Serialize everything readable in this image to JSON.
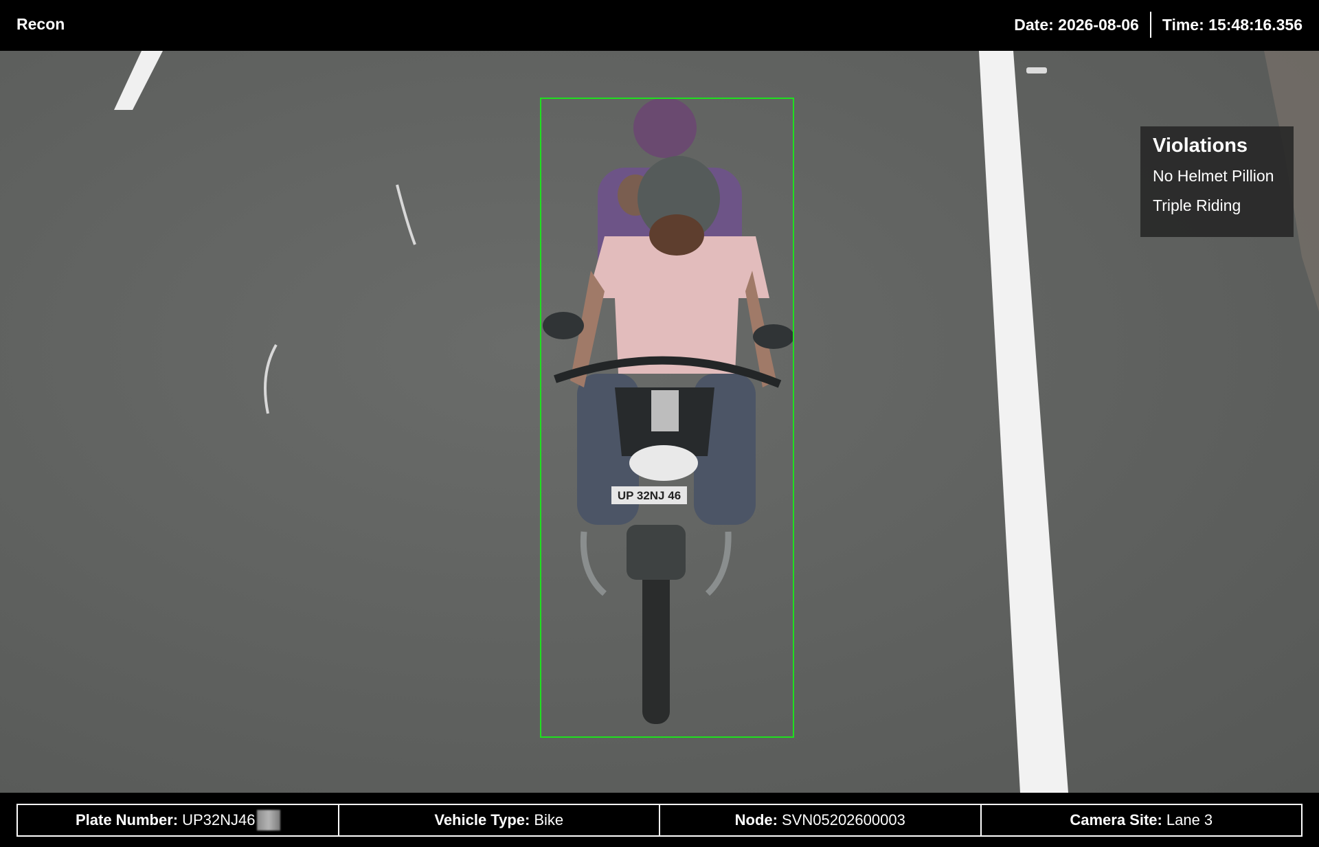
{
  "header": {
    "app_title": "Recon",
    "date_label": "Date:",
    "date_value": "2026-08-06",
    "time_label": "Time:",
    "time_value": "15:48:16.356"
  },
  "violations": {
    "title": "Violations",
    "items": [
      "No Helmet Pillion",
      "Triple Riding"
    ]
  },
  "camera": {
    "plate_on_vehicle": "UP 32NJ 46",
    "detection_color": "#1fe01f"
  },
  "info": {
    "plate_label": "Plate Number:",
    "plate_value": "UP32NJ46",
    "vehicle_label": "Vehicle Type:",
    "vehicle_value": "Bike",
    "node_label": "Node:",
    "node_value": "SVN05202600003",
    "site_label": "Camera Site:",
    "site_value": "Lane 3"
  }
}
